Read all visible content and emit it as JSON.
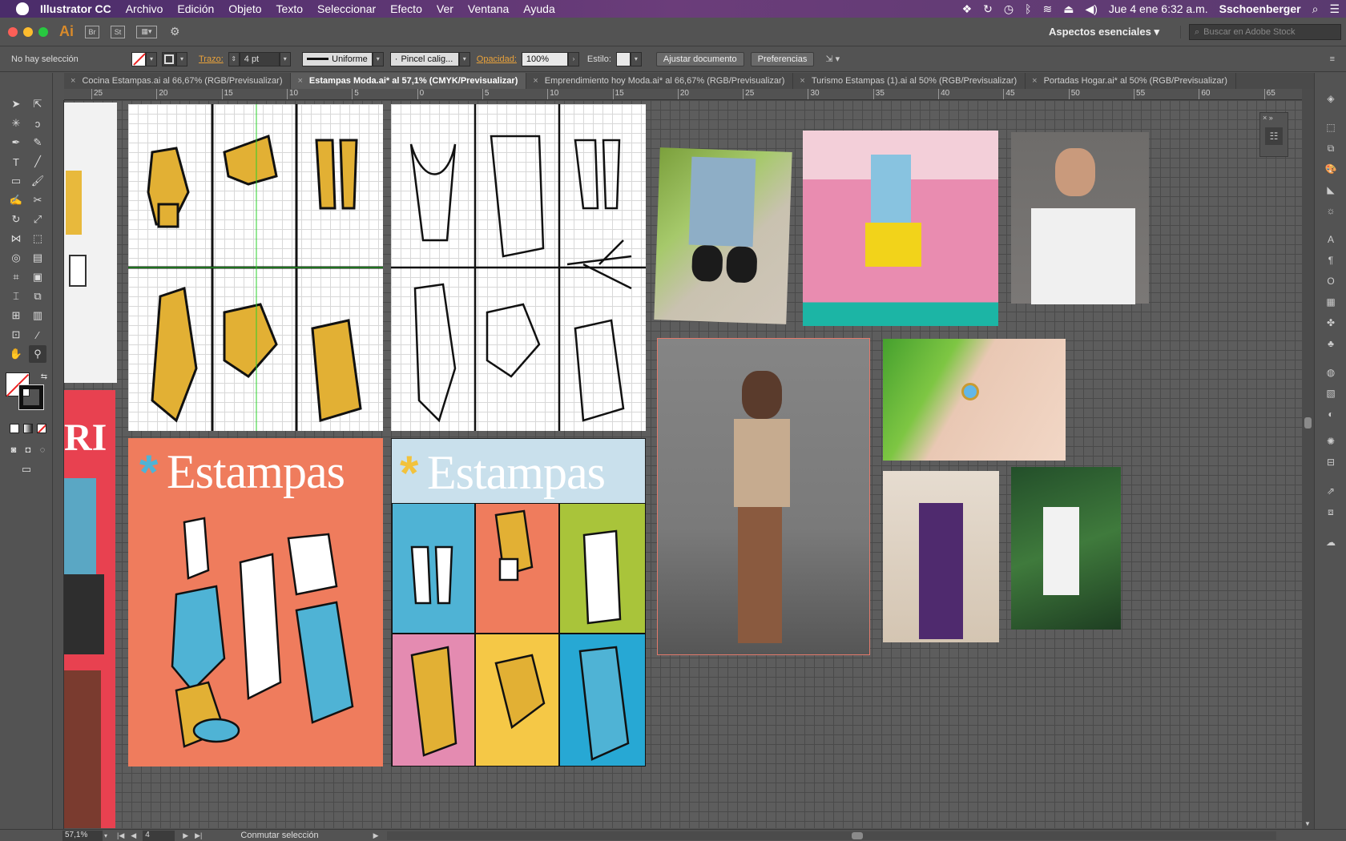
{
  "menubar": {
    "app": "Illustrator CC",
    "items": [
      "Archivo",
      "Edición",
      "Objeto",
      "Texto",
      "Seleccionar",
      "Efecto",
      "Ver",
      "Ventana",
      "Ayuda"
    ],
    "datetime": "Jue 4 ene  6:32 a.m.",
    "user": "Sschoenberger"
  },
  "appbar": {
    "logo": "Ai",
    "br": "Br",
    "st": "St",
    "workspace": "Aspectos esenciales",
    "stock_placeholder": "Buscar en Adobe Stock"
  },
  "control": {
    "selection": "No hay selección",
    "trazo_label": "Trazo:",
    "trazo_value": "4 pt",
    "stroke_profile": "Uniforme",
    "brush": "Pincel calig...",
    "opacity_label": "Opacidad:",
    "opacity_value": "100%",
    "style_label": "Estilo:",
    "adjust_btn": "Ajustar documento",
    "prefs_btn": "Preferencias"
  },
  "tabs": [
    "Cocina Estampas.ai al 66,67% (RGB/Previsualizar)",
    "Estampas Moda.ai* al 57,1% (CMYK/Previsualizar)",
    "Emprendimiento hoy Moda.ai* al 66,67% (RGB/Previsualizar)",
    "Turismo Estampas (1).ai al 50% (RGB/Previsualizar)",
    "Portadas Hogar.ai* al 50% (RGB/Previsualizar)"
  ],
  "active_tab": 1,
  "ruler": {
    "h": [
      "25",
      "20",
      "15",
      "10",
      "5",
      "0",
      "5",
      "10",
      "15",
      "20",
      "25",
      "30",
      "35",
      "40",
      "45",
      "50",
      "55",
      "60",
      "65"
    ]
  },
  "artboards": {
    "poster_title": "Estampas",
    "poster2_title": "Estampas",
    "left_fragment": "RI"
  },
  "status": {
    "zoom": "57,1%",
    "page": "4",
    "action": "Conmutar selección"
  }
}
